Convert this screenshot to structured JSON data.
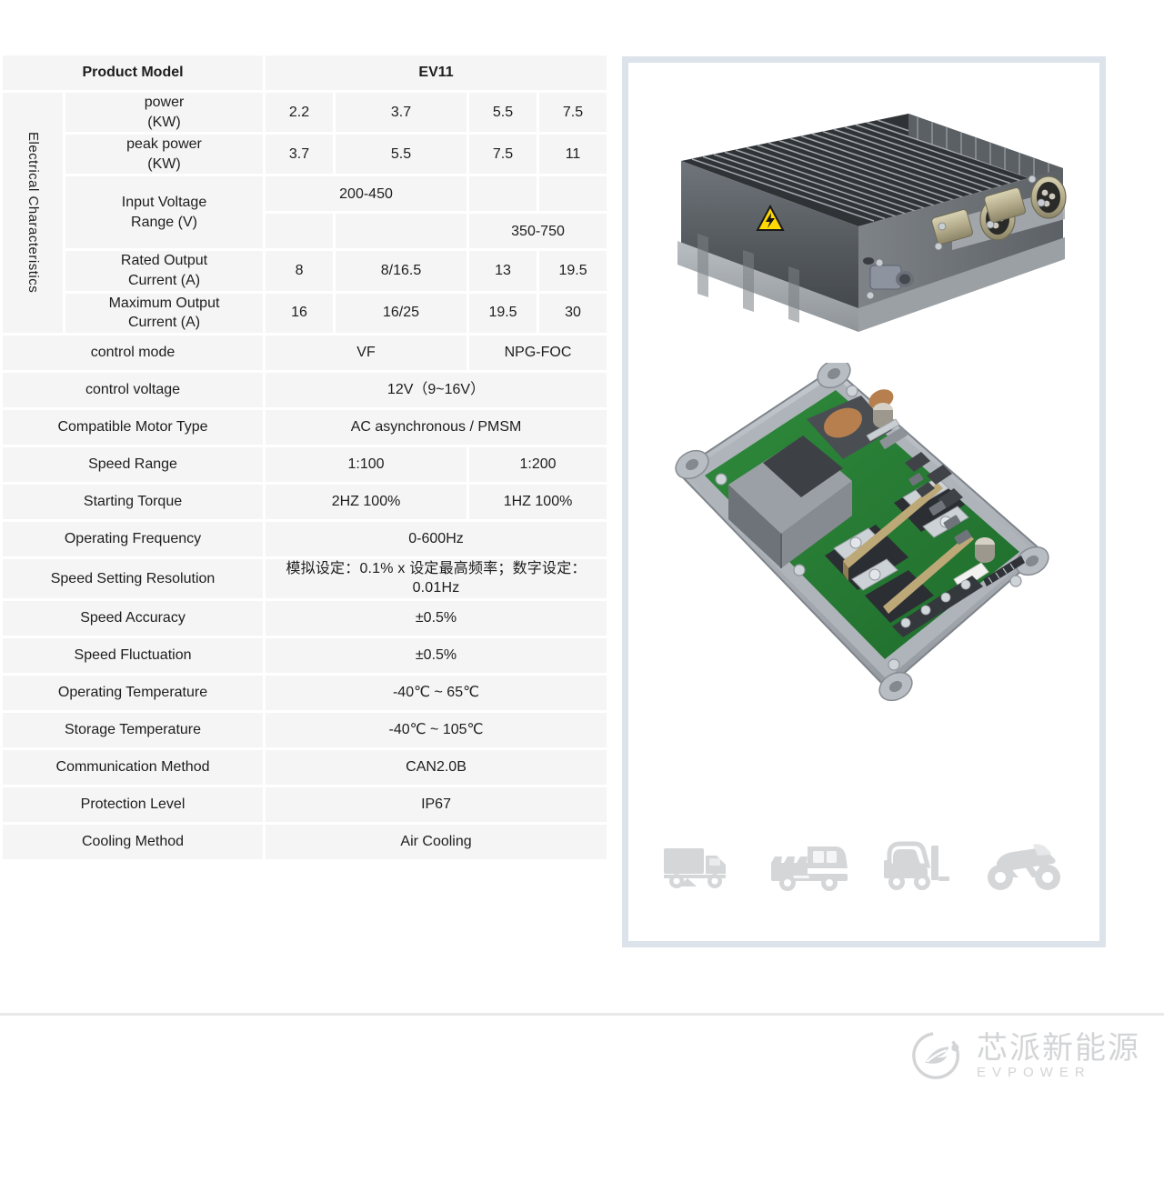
{
  "table": {
    "header": {
      "label": "Product Model",
      "model": "EV11"
    },
    "group_label": "Electrical Characteristics",
    "rows": [
      {
        "label": "power\n(KW)",
        "label_l1": "power",
        "label_l2": "(KW)",
        "cells": [
          "2.2",
          "3.7",
          "5.5",
          "7.5"
        ]
      },
      {
        "label": "peak power\n(KW)",
        "label_l1": "peak power",
        "label_l2": "(KW)",
        "cells": [
          "3.7",
          "5.5",
          "7.5",
          "11"
        ]
      },
      {
        "label_l1": "Input Voltage",
        "label_l2": "Range (V)",
        "sub_a": "200-450",
        "sub_b": "350-750"
      },
      {
        "label_l1": "Rated Output",
        "label_l2": "Current (A)",
        "cells": [
          "8",
          "8/16.5",
          "13",
          "19.5"
        ]
      },
      {
        "label_l1": "Maximum Output",
        "label_l2": "Current (A)",
        "cells": [
          "16",
          "16/25",
          "19.5",
          "30"
        ]
      }
    ],
    "simple_rows": [
      {
        "label": "control mode",
        "left": "VF",
        "right": "NPG-FOC",
        "split": true
      },
      {
        "label": "control voltage",
        "value": "12V（9~16V）",
        "split": false
      },
      {
        "label": "Compatible Motor Type",
        "value": "AC asynchronous / PMSM",
        "split": false
      },
      {
        "label": "Speed Range",
        "left": "1:100",
        "right": "1:200",
        "split": true
      },
      {
        "label": "Starting Torque",
        "left": "2HZ 100%",
        "right": "1HZ  100%",
        "split": true
      },
      {
        "label": "Operating Frequency",
        "value": "0-600Hz",
        "split": false
      },
      {
        "label": "Speed Setting Resolution",
        "value": "模拟设定：0.1% x 设定最高频率；数字设定：0.01Hz",
        "split": false,
        "cjk": true
      },
      {
        "label": "Speed Accuracy",
        "value": "±0.5%",
        "split": false
      },
      {
        "label": "Speed Fluctuation",
        "value": "±0.5%",
        "split": false
      },
      {
        "label": "Operating Temperature",
        "value": "-40℃ ~ 65℃",
        "split": false
      },
      {
        "label": "Storage Temperature",
        "value": "-40℃ ~ 105℃",
        "split": false
      },
      {
        "label": "Communication Method",
        "value": "CAN2.0B",
        "split": false
      },
      {
        "label": "Protection Level",
        "value": "IP67",
        "split": false
      },
      {
        "label": "Cooling Method",
        "value": "Air Cooling",
        "split": false
      }
    ]
  },
  "panel": {
    "images": [
      {
        "name": "motor-controller-housing",
        "alt": "EV11 controller with finned heatsink housing and connectors"
      },
      {
        "name": "motor-controller-pcb",
        "alt": "EV11 internal PCB assembly"
      }
    ],
    "applications": [
      {
        "name": "truck-icon",
        "label": "truck"
      },
      {
        "name": "utility-vehicle-icon",
        "label": "utility vehicle"
      },
      {
        "name": "forklift-icon",
        "label": "forklift"
      },
      {
        "name": "atv-icon",
        "label": "ATV"
      }
    ],
    "warning_label": "high-voltage"
  },
  "footer": {
    "brand_cn": "芯派新能源",
    "brand_en": "EVPOWER"
  },
  "colors": {
    "label_bg": "#d5dde6",
    "value_bg": "#f5f5f6",
    "panel_border": "#dce3eb",
    "brand_gray": "#d3d4d6",
    "warning_yellow": "#ffd900"
  }
}
